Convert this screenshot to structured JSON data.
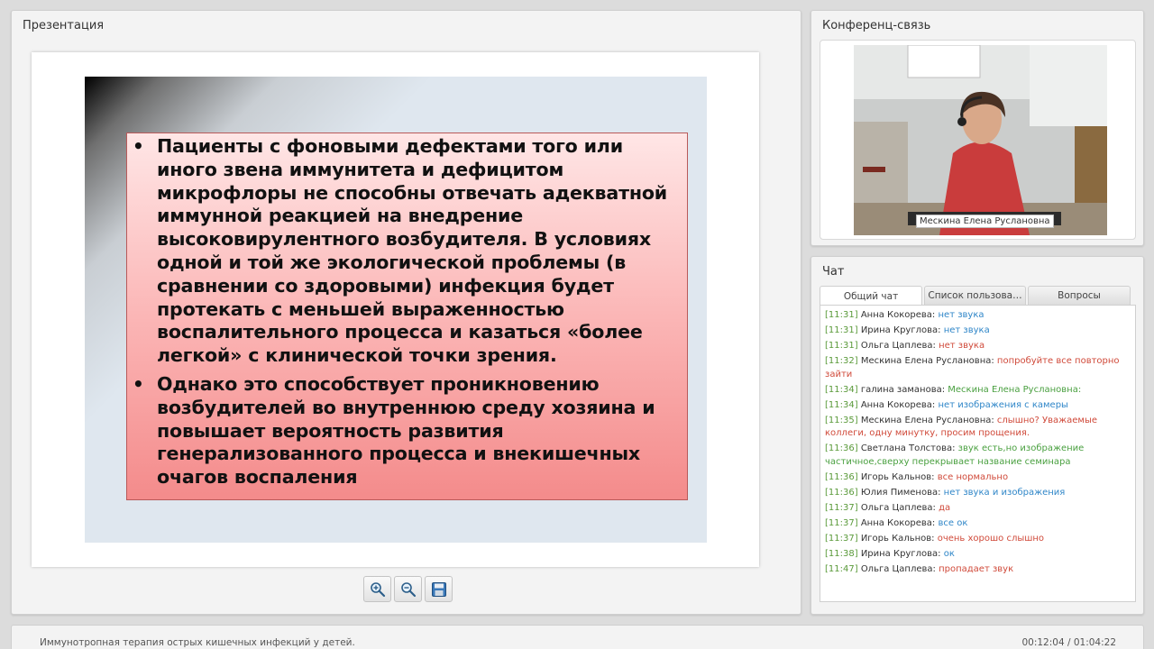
{
  "presentation": {
    "title": "Презентация",
    "slide": {
      "bullets": [
        "Пациенты с фоновыми дефектами того или иного звена иммунитета и дефицитом микрофлоры не способны отвечать адекватной иммунной реакцией на внедрение высоковирулентного возбудителя. В условиях одной и той же экологической проблемы (в сравнении со здоровыми) инфекция будет протекать с меньшей выраженностью воспалительного процесса и казаться «более легкой» с клинической точки зрения.",
        "Однако это способствует проникновению возбудителей во внутреннюю среду хозяина и повышает вероятность развития генерализованного процесса и внекишечных очагов воспаления"
      ],
      "bullet_symbol": "•"
    },
    "toolbar": {
      "zoom_in_icon": "zoom-in-icon",
      "zoom_out_icon": "zoom-out-icon",
      "save_icon": "save-icon"
    }
  },
  "conference": {
    "title": "Конференц-связь",
    "speaker_name": "Мескина Елена Руслановна"
  },
  "chat": {
    "title": "Чат",
    "tabs": [
      {
        "label": "Общий чат",
        "active": true
      },
      {
        "label": "Список пользова…",
        "active": false
      },
      {
        "label": "Вопросы",
        "active": false
      }
    ],
    "messages": [
      {
        "time": "[11:31]",
        "author": "Анна Кокорева:",
        "text": "нет звука",
        "color": "#2f86c8"
      },
      {
        "time": "[11:31]",
        "author": "Ирина Круглова:",
        "text": "нет звука",
        "color": "#2f86c8"
      },
      {
        "time": "[11:31]",
        "author": "Ольга Цаплева:",
        "text": "нет звука",
        "color": "#d04a3a"
      },
      {
        "time": "[11:32]",
        "author": "Мескина Елена Руслановна:",
        "text": "попробуйте все повторно зайти",
        "color": "#d04a3a"
      },
      {
        "time": "[11:34]",
        "author": "галина заманова:",
        "text": "Мескина Елена Руслановна:",
        "color": "#4aa040"
      },
      {
        "time": "[11:34]",
        "author": "Анна Кокорева:",
        "text": "нет изображения с камеры",
        "color": "#2f86c8"
      },
      {
        "time": "[11:35]",
        "author": "Мескина Елена Руслановна:",
        "text": "слышно? Уважаемые коллеги, одну минутку, просим прощения.",
        "color": "#d04a3a"
      },
      {
        "time": "[11:36]",
        "author": "Светлана Толстова:",
        "text": "звук есть,но изображение частичное,сверху перекрывает название семинара",
        "color": "#4aa040"
      },
      {
        "time": "[11:36]",
        "author": "Игорь Кальнов:",
        "text": "все нормально",
        "color": "#d04a3a"
      },
      {
        "time": "[11:36]",
        "author": "Юлия Пименова:",
        "text": "нет звука и изображения",
        "color": "#2f86c8"
      },
      {
        "time": "[11:37]",
        "author": "Ольга Цаплева:",
        "text": "да",
        "color": "#d04a3a"
      },
      {
        "time": "[11:37]",
        "author": "Анна Кокорева:",
        "text": "все ок",
        "color": "#2f86c8"
      },
      {
        "time": "[11:37]",
        "author": "Игорь Кальнов:",
        "text": "очень хорошо слышно",
        "color": "#d04a3a"
      },
      {
        "time": "[11:38]",
        "author": "Ирина Круглова:",
        "text": "ок",
        "color": "#2f86c8"
      },
      {
        "time": "[11:47]",
        "author": "Ольга Цаплева:",
        "text": "пропадает звук",
        "color": "#d04a3a"
      }
    ]
  },
  "footer": {
    "title": "Иммунотропная терапия острых кишечных инфекций у детей.",
    "time": "00:12:04 / 01:04:22"
  }
}
